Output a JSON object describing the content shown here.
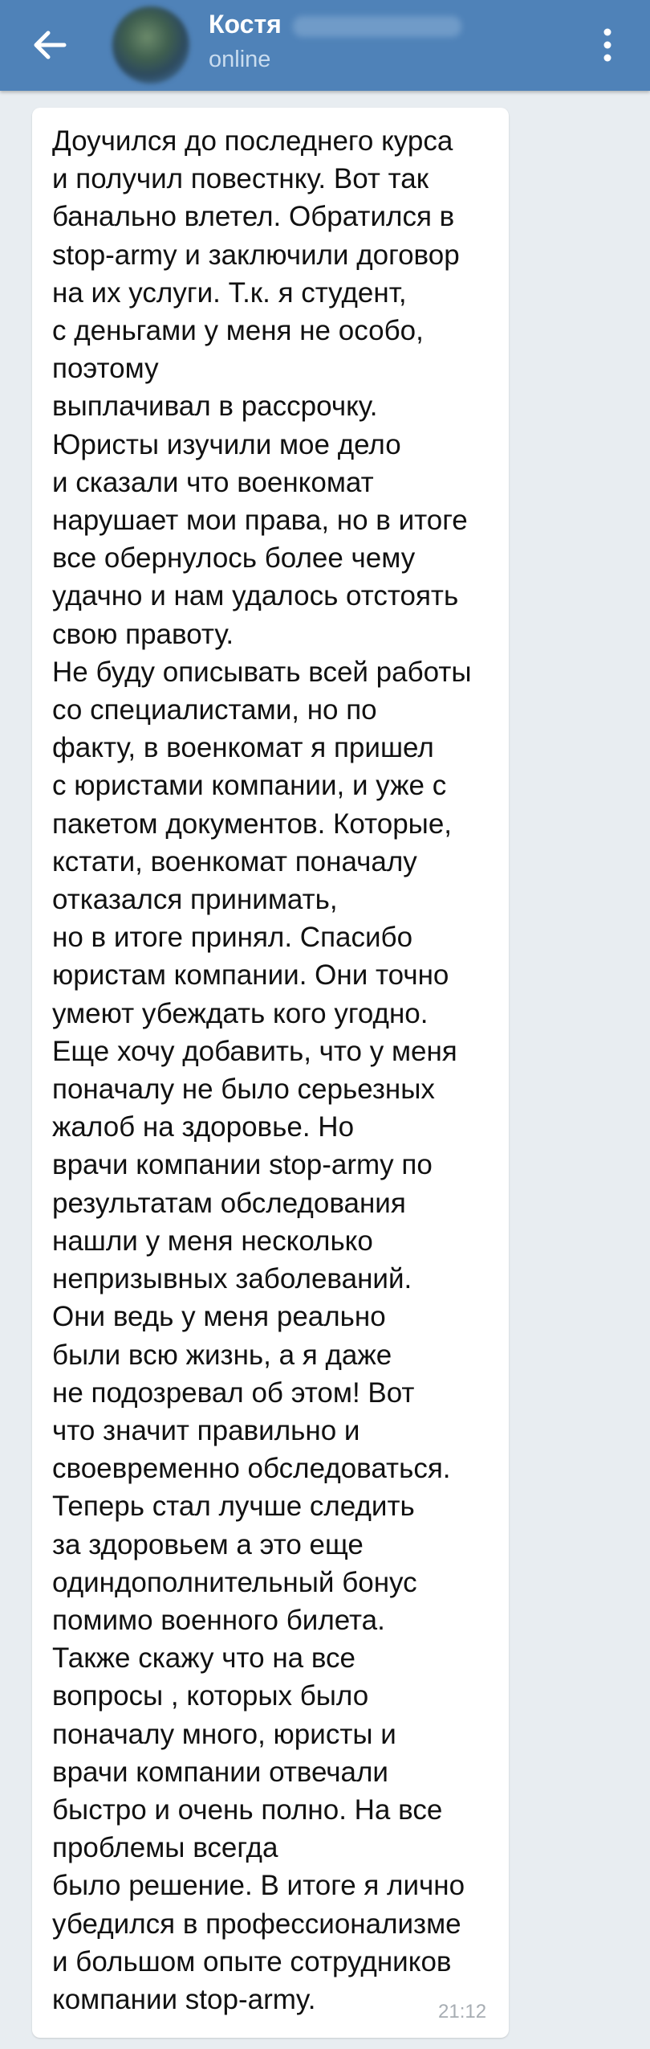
{
  "header": {
    "contact_name": "Костя",
    "status": "online",
    "back_icon": "arrow-left-icon",
    "menu_icon": "more-vertical-icon"
  },
  "message": {
    "lines": [
      "Доучился до последнего курса",
      "и получил повестнку. Вот так",
      "банально влетел. Обратился в",
      "stop-army и заключили договор",
      "на их услуги. Т.к. я студент,",
      "с деньгами у меня не особо,",
      "поэтому",
      "выплачивал в рассрочку.",
      "Юристы изучили мое дело",
      "и сказали что военкомат",
      "нарушает мои права, но в итоге",
      "все обернулось более чему",
      "удачно и нам удалось отстоять",
      "свою правоту.",
      "Не буду описывать всей работы",
      "со специалистами, но по",
      "факту, в военкомат я пришел",
      "с юристами компании, и уже с",
      "пакетом документов. Которые,",
      "кстати, военкомат поначалу",
      "отказался принимать,",
      "но в итоге принял. Спасибо",
      "юристам компании. Они точно",
      "умеют убеждать кого угодно.",
      "Еще хочу добавить, что у меня",
      "поначалу не было серьезных",
      "жалоб на здоровье. Но",
      "врачи компании stop-army по",
      "результатам обследования",
      "нашли у меня несколько",
      "непризывных заболеваний.",
      "Они ведь у меня реально",
      "были всю жизнь, а я даже",
      "не подозревал об этом! Вот",
      "что значит правильно и",
      "своевременно обследоваться.",
      "Теперь стал лучше следить",
      "за здоровьем а это еще",
      "одиндополнительный бонус",
      "помимо военного билета.",
      "Также скажу что на все",
      "вопросы , которых было",
      "поначалу много, юристы и",
      "врачи компании отвечали",
      "быстро и очень полно. На все",
      "проблемы всегда",
      "было решение. В итоге я лично",
      "убедился в профессионализме",
      "и большом опыте сотрудников",
      "компании stop-army."
    ],
    "time": "21:12"
  },
  "colors": {
    "header_bg": "#4f82b8",
    "chat_bg": "#e8edf1",
    "bubble_bg": "#ffffff",
    "time_text": "#a7adb3"
  }
}
